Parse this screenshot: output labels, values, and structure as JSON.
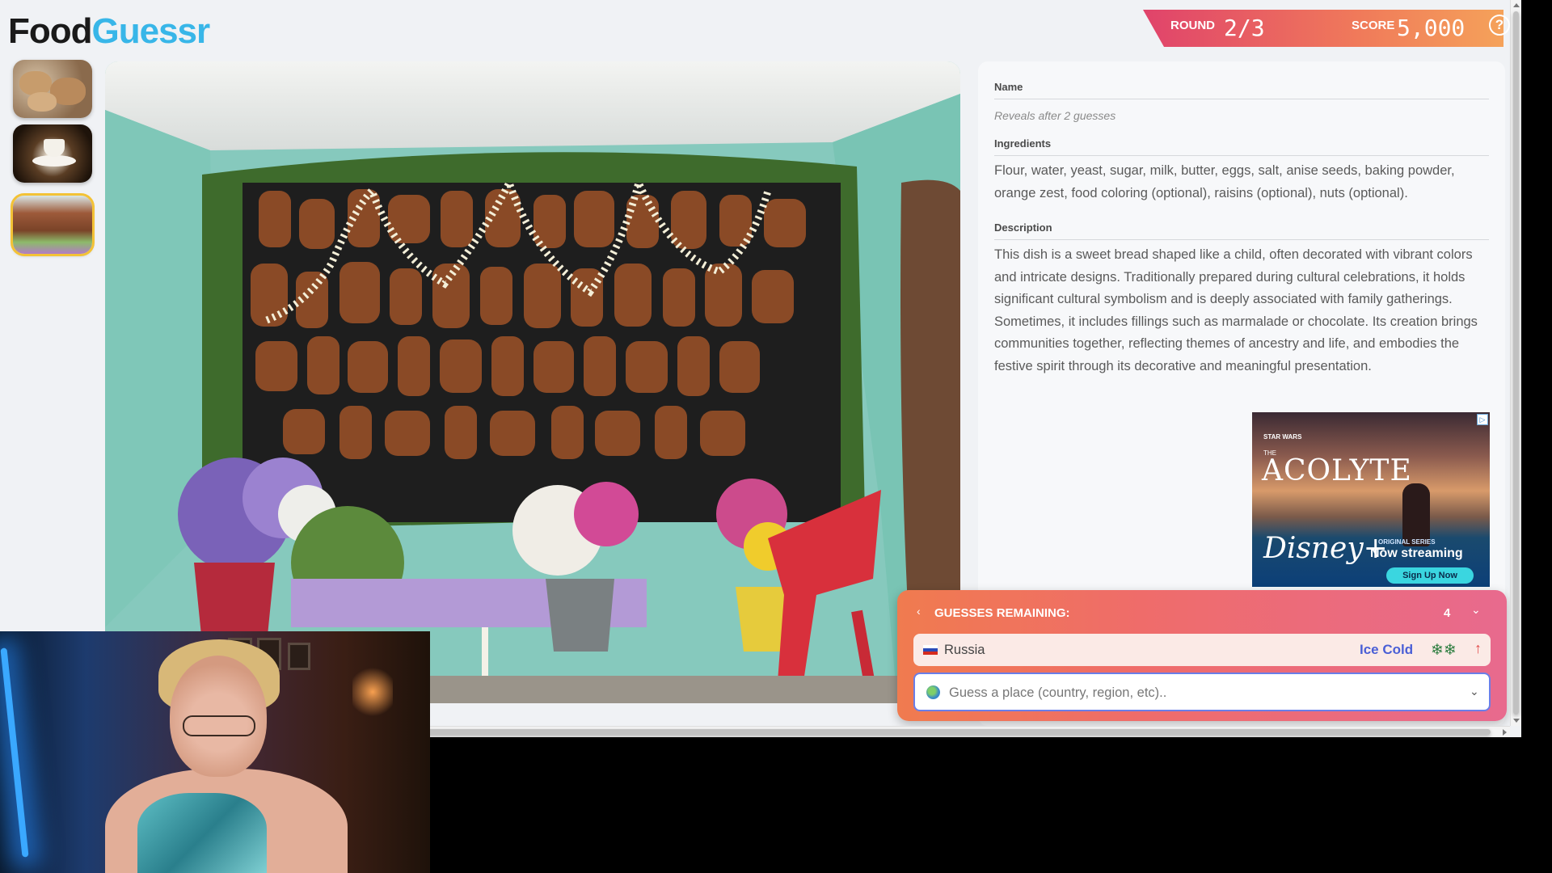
{
  "logo": {
    "part1": "Food",
    "part2": "Guessr"
  },
  "scorebar": {
    "round_label": "ROUND",
    "round_value": "2/3",
    "score_label": "SCORE",
    "score_value": "5,000",
    "help": "?"
  },
  "thumbnails": [
    {
      "name": "bread-thumbnail",
      "active": false
    },
    {
      "name": "coffee-thumbnail",
      "active": false
    },
    {
      "name": "altar-thumbnail",
      "active": true
    }
  ],
  "info": {
    "name_title": "Name",
    "name_value": "Reveals after 2 guesses",
    "ingredients_title": "Ingredients",
    "ingredients_value": "Flour, water, yeast, sugar, milk, butter, eggs, salt, anise seeds, baking powder, orange zest, food coloring (optional), raisins (optional), nuts (optional).",
    "description_title": "Description",
    "description_value": "This dish is a sweet bread shaped like a child, often decorated with vibrant colors and intricate designs. Traditionally prepared during cultural celebrations, it holds significant cultural symbolism and is deeply associated with family gatherings. Sometimes, it includes fillings such as marmalade or chocolate. Its creation brings communities together, reflecting themes of ancestry and life, and embodies the festive spirit through its decorative and meaningful presentation."
  },
  "ad": {
    "franchise": "STAR WARS",
    "the": "THE",
    "title": "ACOLYTE",
    "brand": "Disney+",
    "series": "ORIGINAL SERIES",
    "status": "Now streaming",
    "cta": "Sign Up Now"
  },
  "guesses": {
    "header": "GUESSES REMAINING:",
    "count": "4",
    "rows": [
      {
        "country": "Russia",
        "temperature": "Ice Cold",
        "snowflakes": "❄❄",
        "direction": "↑"
      }
    ],
    "input_placeholder": "Guess a place (country, region, etc)..",
    "collapse_icon": "‹",
    "chevron_icon": "⌄"
  },
  "colors": {
    "accent_blue": "#38b6e8",
    "score_gradient_start": "#e0436b",
    "score_gradient_end": "#f5a25a",
    "ice_cold": "#4a5fd6"
  }
}
